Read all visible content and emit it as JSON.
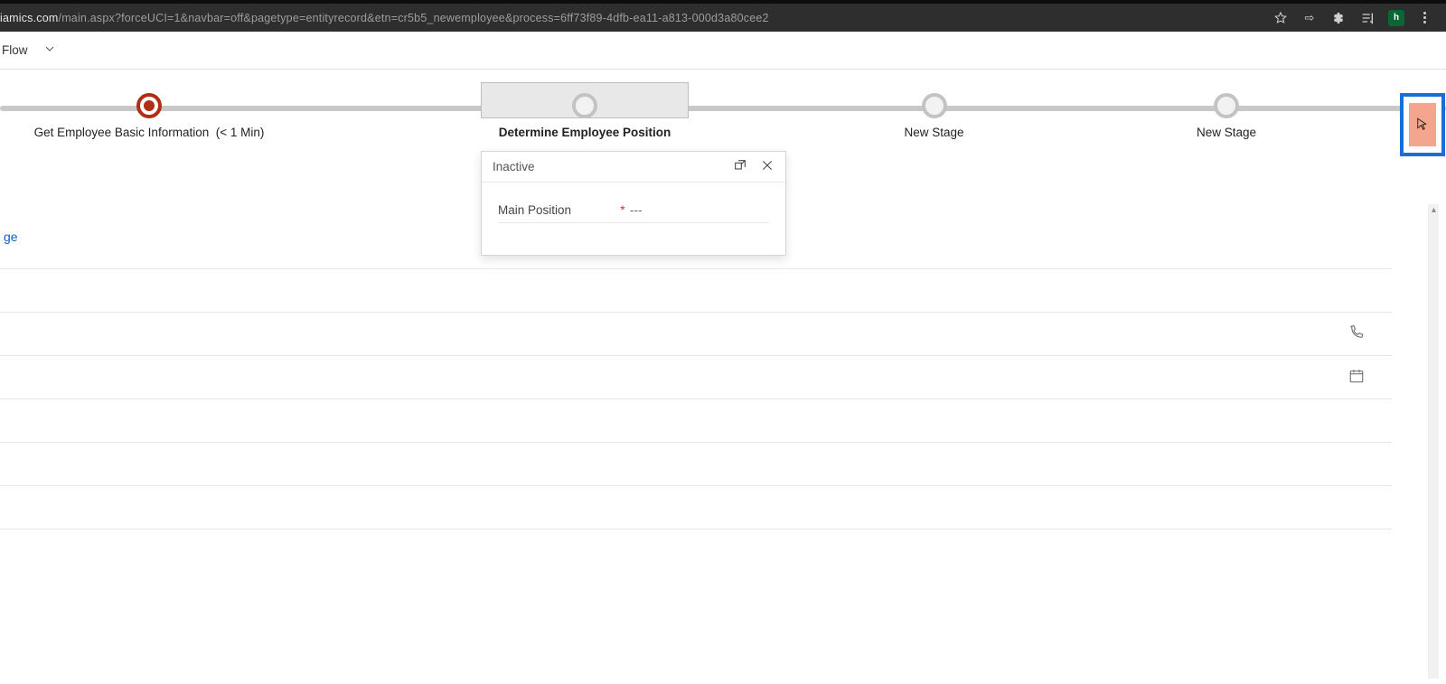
{
  "browser": {
    "url_lead": "iamics.com",
    "url_path": "/main.aspx?forceUCI=1&navbar=off&pagetype=entityrecord&etn=cr5b5_newemployee&process=6ff73f89-4dfb-ea11-a813-000d3a80cee2",
    "avatar_letter": "h"
  },
  "flow": {
    "label": "Flow"
  },
  "stages": [
    {
      "label": "Get Employee Basic Information",
      "duration": "(< 1 Min)",
      "active": true
    },
    {
      "label": "Determine Employee Position",
      "selected": true
    },
    {
      "label": "New Stage"
    },
    {
      "label": "New Stage"
    }
  ],
  "flyout": {
    "status": "Inactive",
    "field_label": "Main Position",
    "field_value": "---"
  },
  "form": {
    "link_fragment": "ge"
  }
}
